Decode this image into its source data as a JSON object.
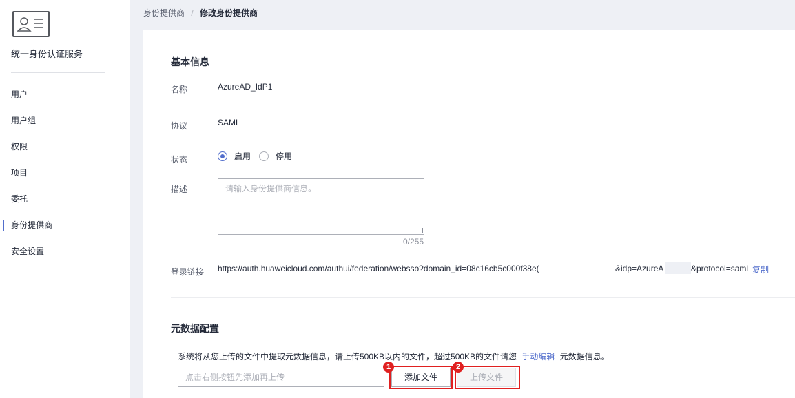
{
  "sidebar": {
    "logo_icon": "id-card-icon",
    "title": "统一身份认证服务",
    "items": [
      {
        "label": "用户"
      },
      {
        "label": "用户组"
      },
      {
        "label": "权限"
      },
      {
        "label": "项目"
      },
      {
        "label": "委托"
      },
      {
        "label": "身份提供商",
        "active": true
      },
      {
        "label": "安全设置"
      }
    ]
  },
  "breadcrumb": {
    "parent": "身份提供商",
    "separator": "/",
    "current": "修改身份提供商"
  },
  "basic_info": {
    "title": "基本信息",
    "name_label": "名称",
    "name_value": "AzureAD_IdP1",
    "protocol_label": "协议",
    "protocol_value": "SAML",
    "status_label": "状态",
    "status_options": [
      "启用",
      "停用"
    ],
    "status_selected": "启用",
    "desc_label": "描述",
    "desc_placeholder": "请输入身份提供商信息。",
    "desc_counter": "0/255",
    "login_link_label": "登录链接",
    "login_link_part1": "https://auth.huaweicloud.com/authui/federation/websso?domain_id=08c16cb5c000f38e(",
    "login_link_part2": "&idp=AzureA",
    "login_link_part3": "&protocol=saml",
    "copy_label": "复制"
  },
  "metadata": {
    "title": "元数据配置",
    "hint_prefix": "系统将从您上传的文件中提取元数据信息，请上传500KB以内的文件，超过500KB的文件请您",
    "hint_link": "手动编辑",
    "hint_suffix": "元数据信息。",
    "file_placeholder": "点击右侧按钮先添加再上传",
    "add_file_label": "添加文件",
    "upload_label": "上传文件"
  },
  "annotations": {
    "badge1": "1",
    "badge2": "2",
    "color": "#e02020"
  },
  "colors": {
    "accent": "#526ecc",
    "background": "#eef0f5"
  }
}
